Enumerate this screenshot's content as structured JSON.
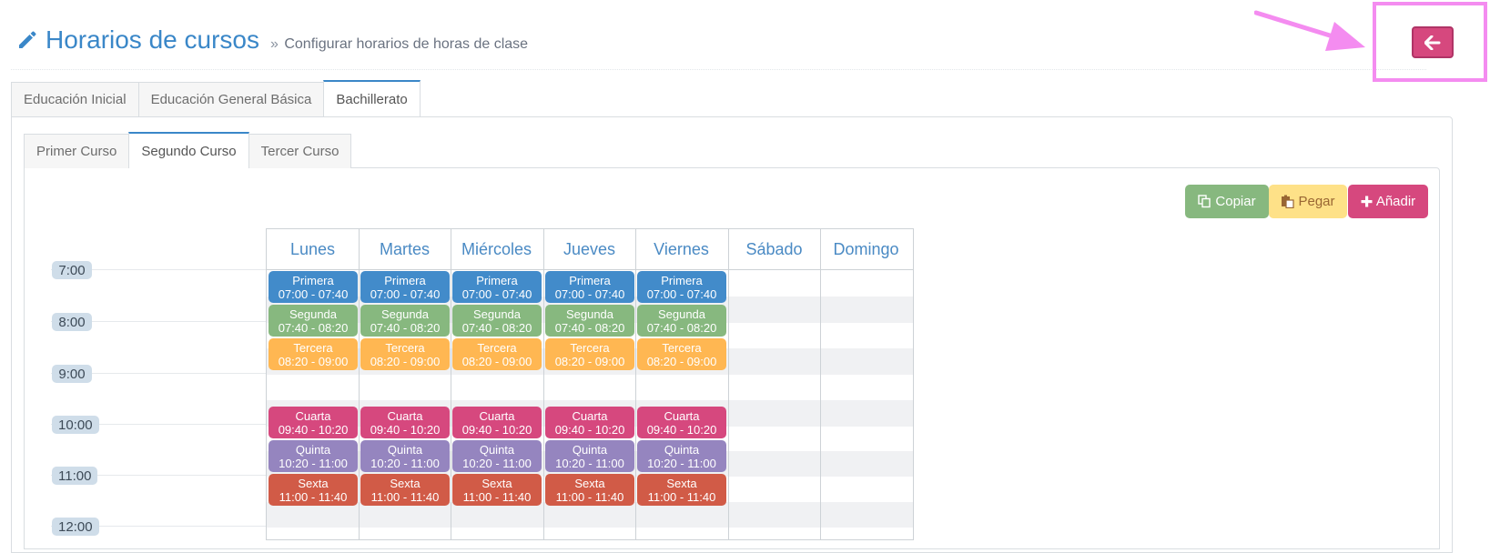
{
  "header": {
    "title": "Horarios de cursos",
    "subtitle": "Configurar horarios de horas de clase",
    "subtitle_prefix": "»"
  },
  "level_tabs": [
    "Educación Inicial",
    "Educación General Básica",
    "Bachillerato"
  ],
  "course_tabs": [
    "Primer Curso",
    "Segundo Curso",
    "Tercer Curso"
  ],
  "actions": {
    "copy": "Copiar",
    "paste": "Pegar",
    "add": "Añadir"
  },
  "times": [
    "7:00",
    "8:00",
    "9:00",
    "10:00",
    "11:00",
    "12:00"
  ],
  "days": [
    "Lunes",
    "Martes",
    "Miércoles",
    "Jueves",
    "Viernes",
    "Sábado",
    "Domingo"
  ],
  "periods": [
    {
      "name": "Primera",
      "range": "07:00 - 07:40"
    },
    {
      "name": "Segunda",
      "range": "07:40 - 08:20"
    },
    {
      "name": "Tercera",
      "range": "08:20 - 09:00"
    },
    {
      "name": "Cuarta",
      "range": "09:40 - 10:20"
    },
    {
      "name": "Quinta",
      "range": "10:20 - 11:00"
    },
    {
      "name": "Sexta",
      "range": "11:00 - 11:40"
    }
  ],
  "icons": {
    "title": "pencil-icon",
    "back": "arrow-left-icon",
    "copy": "copy-icon",
    "paste": "paste-icon",
    "add": "plus-icon"
  },
  "colors": {
    "accent": "#3a87c8",
    "primera": "#428bca",
    "segunda": "#87b87f",
    "tercera": "#ffb752",
    "cuarta": "#d6487e",
    "quinta": "#9585bf",
    "sexta": "#d15b47",
    "back_button": "#d6487e",
    "annotation": "#f48cf0"
  }
}
